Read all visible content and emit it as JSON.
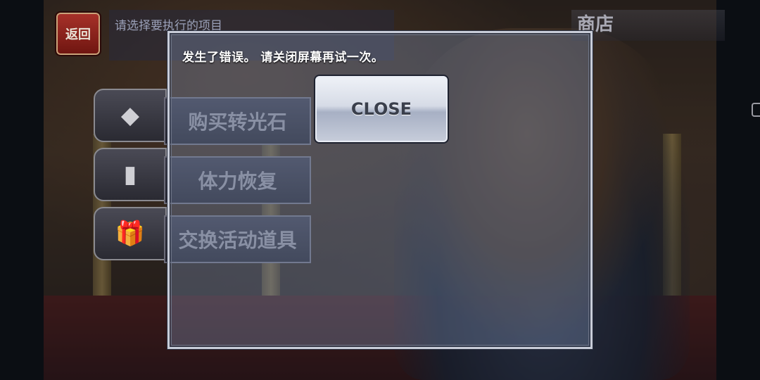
{
  "header": {
    "back_label": "返回",
    "prompt": "请选择要执行的项目",
    "screen_title": "商店"
  },
  "menu": {
    "items": [
      {
        "label": "购买转光石",
        "icon": "crystal-icon"
      },
      {
        "label": "体力恢复",
        "icon": "bottle-icon"
      },
      {
        "label": "交换活动道具",
        "icon": "gift-icon"
      }
    ]
  },
  "dialog": {
    "message": "发生了错误。 请关闭屏幕再试一次。",
    "close_label": "CLOSE"
  }
}
